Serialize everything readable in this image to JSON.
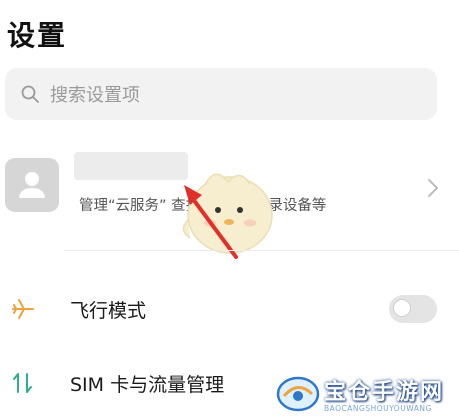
{
  "header": {
    "title": "设置"
  },
  "search": {
    "placeholder": "搜索设置项"
  },
  "account": {
    "services": [
      "管理“云服务”",
      "查找手机”",
      "登录设备等"
    ]
  },
  "settings": [
    {
      "label": "飞行模式",
      "icon": "airplane-icon",
      "toggle": false
    },
    {
      "label": "SIM 卡与流量管理",
      "icon": "sim-data-icon"
    }
  ],
  "watermark": {
    "title": "宝仓手游网",
    "subtitle": "BAOCANGSHOUYOUWANG"
  },
  "colors": {
    "accent_orange": "#f0a23c",
    "icon_green": "#2bb08f",
    "arrow_red": "#e0302a",
    "search_bg": "#f2f2f2"
  }
}
